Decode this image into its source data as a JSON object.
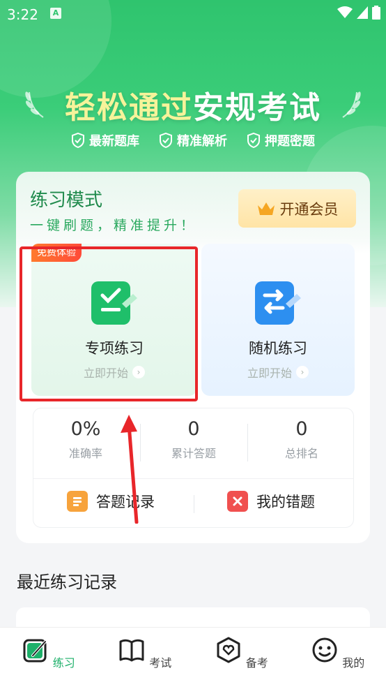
{
  "status_bar": {
    "time": "3:22",
    "notif_icon": "A"
  },
  "hero": {
    "headline_highlight": "轻松通过",
    "headline_rest": "安规考试",
    "features": [
      "最新题库",
      "精准解析",
      "押题密题"
    ]
  },
  "practice": {
    "title": "练习模式",
    "subtitle": "一键刷题，精准提升！",
    "vip_label": "开通会员",
    "modes": [
      {
        "tag": "免费体验",
        "name": "专项练习",
        "action": "立即开始"
      },
      {
        "name": "随机练习",
        "action": "立即开始"
      }
    ],
    "stats": [
      {
        "value": "0%",
        "label": "准确率"
      },
      {
        "value": "0",
        "label": "累计答题"
      },
      {
        "value": "0",
        "label": "总排名"
      }
    ],
    "actions": [
      {
        "label": "答题记录"
      },
      {
        "label": "我的错题"
      }
    ]
  },
  "recent": {
    "title": "最近练习记录"
  },
  "nav": {
    "items": [
      {
        "label": "练习",
        "active": true
      },
      {
        "label": "考试",
        "active": false
      },
      {
        "label": "备考",
        "active": false
      },
      {
        "label": "我的",
        "active": false
      }
    ]
  },
  "colors": {
    "brand": "#1eb06a",
    "highlight_box": "#e8262a"
  }
}
